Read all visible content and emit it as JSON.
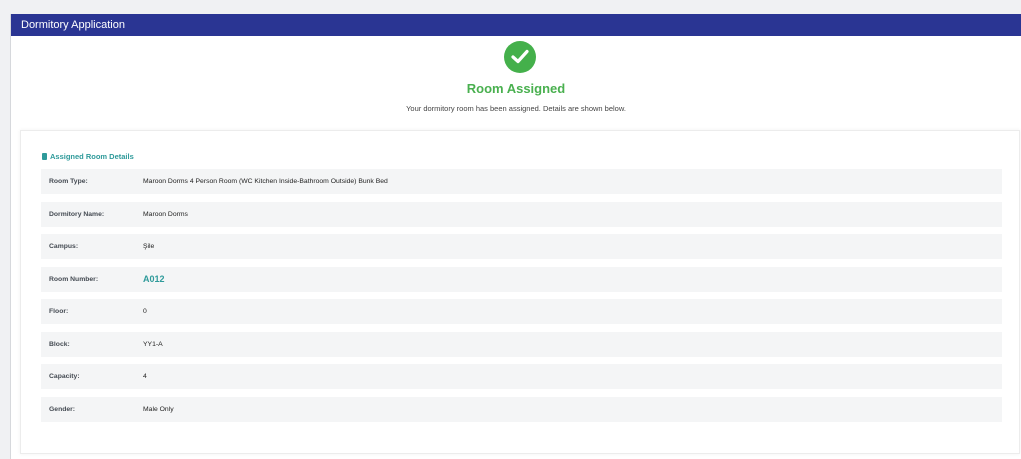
{
  "window": {
    "title": "Dormitory Application"
  },
  "status": {
    "icon": "check-circle-icon",
    "title": "Room Assigned",
    "message": "Your dormitory room has been assigned. Details are shown below."
  },
  "details": {
    "section_icon": "document-icon",
    "section_title": "Assigned Room Details",
    "rows": [
      {
        "label": "Room Type:",
        "value": "Maroon Dorms 4 Person Room (WC Kitchen Inside-Bathroom Outside) Bunk Bed"
      },
      {
        "label": "Dormitory Name:",
        "value": "Maroon Dorms"
      },
      {
        "label": "Campus:",
        "value": "Şile"
      },
      {
        "label": "Room Number:",
        "value": "A012"
      },
      {
        "label": "Floor:",
        "value": "0"
      },
      {
        "label": "Block:",
        "value": "YY1-A"
      },
      {
        "label": "Capacity:",
        "value": "4"
      },
      {
        "label": "Gender:",
        "value": "Male Only"
      }
    ]
  },
  "colors": {
    "header": "#2a3593",
    "success": "#44b04b",
    "accent": "#2e9a9a"
  }
}
